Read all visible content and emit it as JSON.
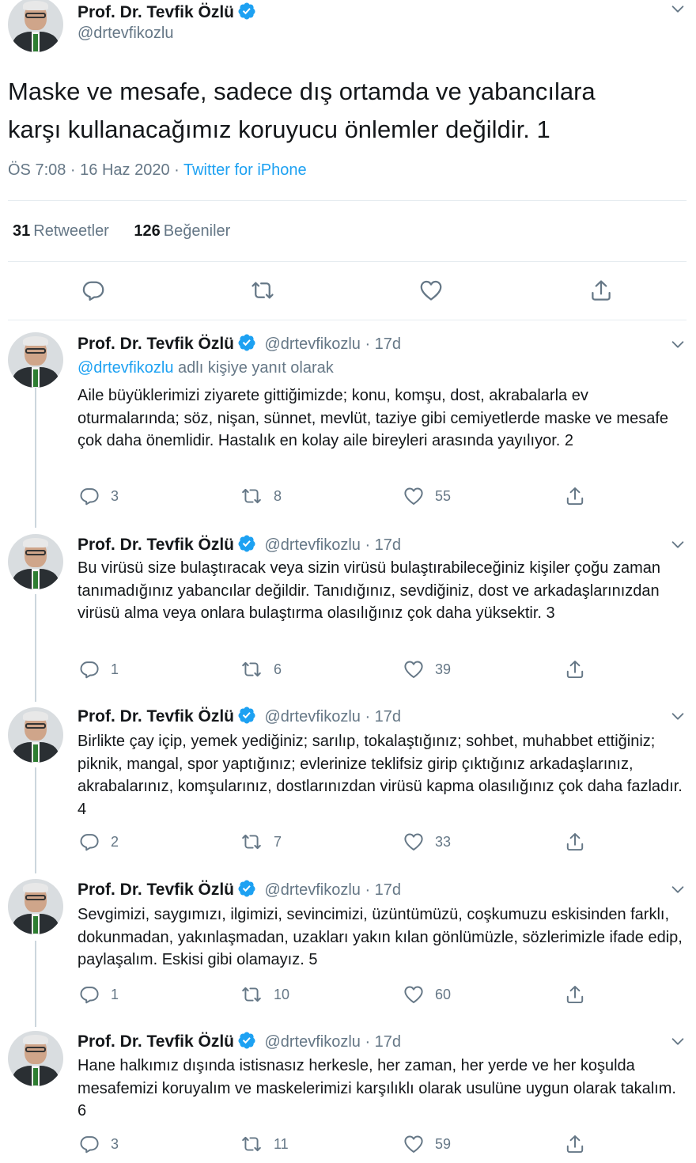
{
  "main_tweet": {
    "author_name": "Prof. Dr. Tevfik Özlü",
    "handle": "@drtevfikozlu",
    "text_line1": "Maske ve mesafe, sadece dış ortamda ve yabancılara",
    "text_line2": "karşı kullanacağımız koruyucu önlemler değildir. 1",
    "time": "ÖS 7:08 · 16 Haz 2020 · ",
    "source": "Twitter for iPhone",
    "retweet_count": "31",
    "retweet_label": "Retweetler",
    "like_count": "126",
    "like_label": "Beğeniler"
  },
  "replies": [
    {
      "author_name": "Prof. Dr. Tevfik Özlü",
      "handle_time": "@drtevfikozlu · 17d",
      "reply_to_link": "@drtevfikozlu",
      "reply_to_suffix": " adlı kişiye yanıt olarak",
      "text": "Aile büyüklerimizi ziyarete gittiğimizde; konu, komşu, dost, akrabalarla ev oturmalarında; söz, nişan, sünnet, mevlüt, taziye gibi cemiyetlerde maske ve mesafe çok daha önemlidir. Hastalık en kolay aile bireyleri arasında yayılıyor. 2",
      "replies": "3",
      "retweets": "8",
      "likes": "55"
    },
    {
      "author_name": "Prof. Dr. Tevfik Özlü",
      "handle_time": "@drtevfikozlu · 17d",
      "text": "Bu virüsü size bulaştıracak veya sizin virüsü bulaştırabileceğiniz kişiler çoğu zaman tanımadığınız yabancılar değildir. Tanıdığınız, sevdiğiniz, dost ve arkadaşlarınızdan virüsü alma veya onlara bulaştırma olasılığınız çok daha yüksektir. 3",
      "replies": "1",
      "retweets": "6",
      "likes": "39"
    },
    {
      "author_name": "Prof. Dr. Tevfik Özlü",
      "handle_time": "@drtevfikozlu · 17d",
      "text": "Birlikte çay içip, yemek yediğiniz; sarılıp, tokalaştığınız; sohbet, muhabbet ettiğiniz; piknik, mangal, spor yaptığınız; evlerinize teklifsiz girip çıktığınız arkadaşlarınız, akrabalarınız, komşularınız, dostlarınızdan virüsü kapma olasılığınız çok daha fazladır. 4",
      "replies": "2",
      "retweets": "7",
      "likes": "33"
    },
    {
      "author_name": "Prof. Dr. Tevfik Özlü",
      "handle_time": "@drtevfikozlu · 17d",
      "text": "Sevgimizi, saygımızı, ilgimizi, sevincimizi, üzüntümüzü, coşkumuzu eskisinden farklı, dokunmadan, yakınlaşmadan, uzakları yakın kılan gönlümüzle, sözlerimizle ifade edip, paylaşalım. Eskisi gibi olamayız. 5",
      "replies": "1",
      "retweets": "10",
      "likes": "60"
    },
    {
      "author_name": "Prof. Dr. Tevfik Özlü",
      "handle_time": "@drtevfikozlu · 17d",
      "text": "Hane halkımız dışında istisnasız herkesle, her zaman, her yerde ve her koşulda mesafemizi koruyalım ve maskelerimizi karşılıklı olarak usulüne uygun olarak takalım. 6",
      "replies": "3",
      "retweets": "11",
      "likes": "59"
    }
  ],
  "colors": {
    "accent": "#1da1f2",
    "text": "#14171a",
    "muted": "#657786",
    "divider": "#e6ecf0"
  },
  "icons": [
    "reply-icon",
    "retweet-icon",
    "like-icon",
    "share-icon",
    "verified-icon",
    "chevron-down-icon"
  ]
}
